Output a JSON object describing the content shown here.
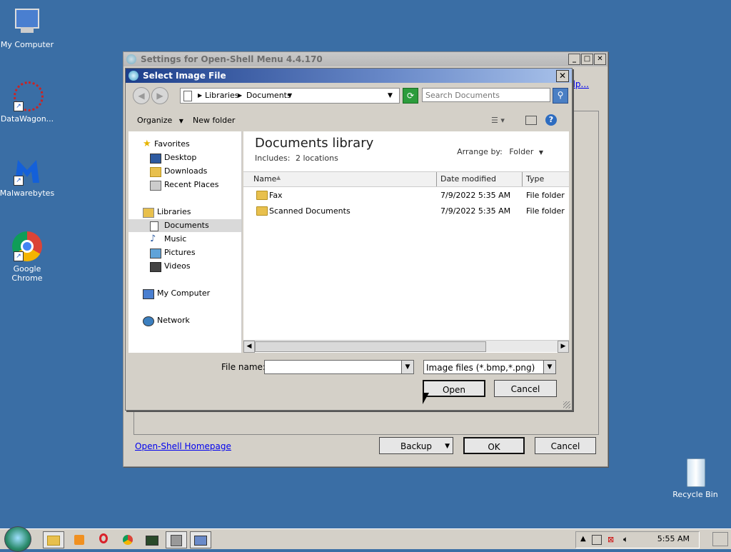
{
  "desktop": {
    "icons": [
      {
        "label": "My Computer"
      },
      {
        "label": "DataWagon..."
      },
      {
        "label": "Malwarebytes"
      },
      {
        "label": "Google Chrome"
      },
      {
        "label": "Recycle Bin"
      }
    ]
  },
  "settings_window": {
    "title": "Settings for Open-Shell Menu 4.4.170",
    "help_link": "elp...",
    "homepage_link": "Open-Shell Homepage",
    "backup_label": "Backup",
    "ok_label": "OK",
    "cancel_label": "Cancel"
  },
  "dialog": {
    "title": "Select Image File",
    "close_glyph": "✕",
    "address": {
      "crumbs": [
        "Libraries",
        "Documents"
      ]
    },
    "search_placeholder": "Search Documents",
    "toolbar": {
      "organize": "Organize",
      "new_folder": "New folder"
    },
    "nav": {
      "favorites": "Favorites",
      "fav_items": [
        "Desktop",
        "Downloads",
        "Recent Places"
      ],
      "libraries": "Libraries",
      "lib_items": [
        "Documents",
        "Music",
        "Pictures",
        "Videos"
      ],
      "computer": "My Computer",
      "network": "Network"
    },
    "library": {
      "title": "Documents library",
      "includes_label": "Includes:",
      "includes_link": "2 locations",
      "arrange_label": "Arrange by:",
      "arrange_value": "Folder"
    },
    "columns": [
      "Name",
      "Date modified",
      "Type"
    ],
    "rows": [
      {
        "name": "Fax",
        "date": "7/9/2022 5:35 AM",
        "type": "File folder"
      },
      {
        "name": "Scanned Documents",
        "date": "7/9/2022 5:35 AM",
        "type": "File folder"
      }
    ],
    "file_name_label": "File name:",
    "file_name_value": "",
    "filter_value": "Image files (*.bmp,*.png)",
    "open_label": "Open",
    "cancel_label": "Cancel"
  },
  "taskbar": {
    "clock": "5:55 AM"
  },
  "colors": {
    "desktop": "#3a6ea5",
    "dialog_title": "#1c3e8a"
  }
}
